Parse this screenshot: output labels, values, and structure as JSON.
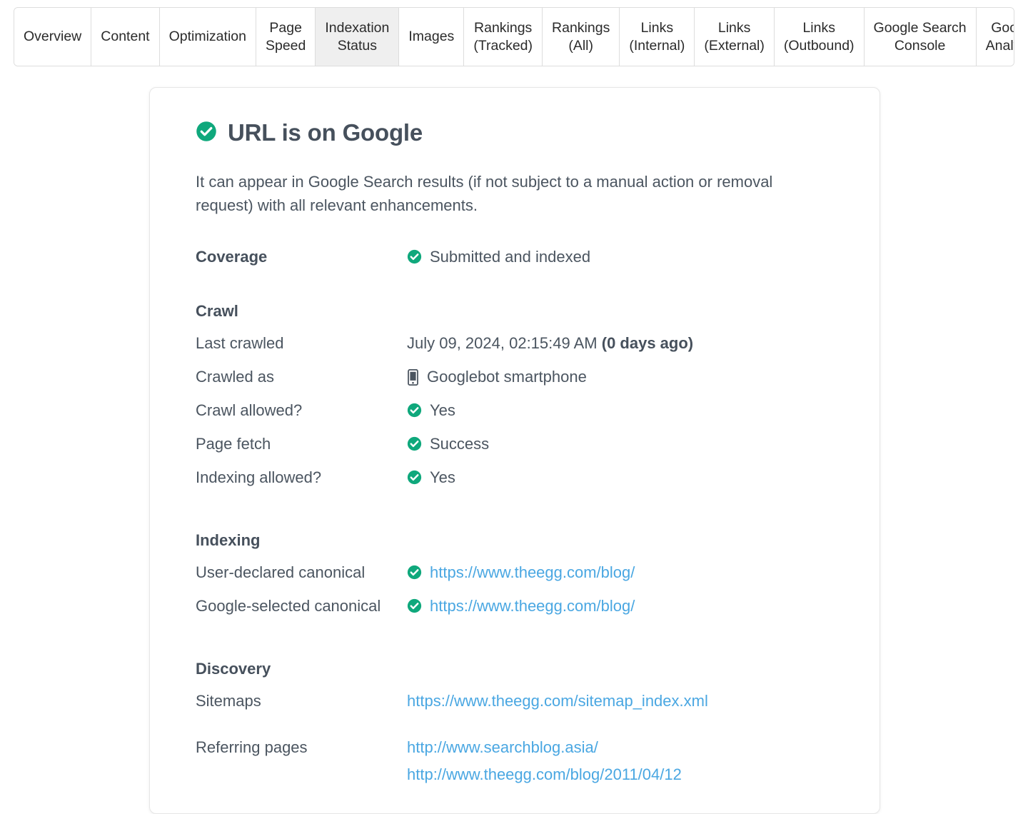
{
  "tabs": [
    {
      "label": "Overview",
      "active": false,
      "name": "tab-overview"
    },
    {
      "label": "Content",
      "active": false,
      "name": "tab-content"
    },
    {
      "label": "Optimization",
      "active": false,
      "name": "tab-optimization"
    },
    {
      "label": "Page\nSpeed",
      "active": false,
      "name": "tab-page-speed"
    },
    {
      "label": "Indexation\nStatus",
      "active": true,
      "name": "tab-indexation-status"
    },
    {
      "label": "Images",
      "active": false,
      "name": "tab-images"
    },
    {
      "label": "Rankings\n(Tracked)",
      "active": false,
      "name": "tab-rankings-tracked"
    },
    {
      "label": "Rankings\n(All)",
      "active": false,
      "name": "tab-rankings-all"
    },
    {
      "label": "Links\n(Internal)",
      "active": false,
      "name": "tab-links-internal"
    },
    {
      "label": "Links\n(External)",
      "active": false,
      "name": "tab-links-external"
    },
    {
      "label": "Links\n(Outbound)",
      "active": false,
      "name": "tab-links-outbound"
    },
    {
      "label": "Google Search\nConsole",
      "active": false,
      "name": "tab-google-search-console"
    },
    {
      "label": "Google\nAnalytics",
      "active": false,
      "name": "tab-google-analytics"
    }
  ],
  "card": {
    "title": "URL is on Google",
    "title_icon": "check-circle-icon",
    "intro": "It can appear in Google Search results (if not subject to a manual action or removal request) with all relevant enhancements.",
    "coverage": {
      "label": "Coverage",
      "icon": "check-circle-icon",
      "value": "Submitted and indexed"
    },
    "crawl": {
      "heading": "Crawl",
      "rows": [
        {
          "label": "Last crawled",
          "value": "July 09, 2024, 02:15:49 AM ",
          "value_bold": "(0 days ago)",
          "icon": null
        },
        {
          "label": "Crawled as",
          "value": "Googlebot smartphone",
          "icon": "smartphone-icon"
        },
        {
          "label": "Crawl allowed?",
          "value": "Yes",
          "icon": "check-circle-icon"
        },
        {
          "label": "Page fetch",
          "value": "Success",
          "icon": "check-circle-icon"
        },
        {
          "label": "Indexing allowed?",
          "value": "Yes",
          "icon": "check-circle-icon"
        }
      ]
    },
    "indexing": {
      "heading": "Indexing",
      "rows": [
        {
          "label": "User-declared canonical",
          "link": "https://www.theegg.com/blog/",
          "icon": "check-circle-icon"
        },
        {
          "label": "Google-selected canonical",
          "link": "https://www.theegg.com/blog/",
          "icon": "check-circle-icon"
        }
      ]
    },
    "discovery": {
      "heading": "Discovery",
      "sitemaps_label": "Sitemaps",
      "sitemaps_link": "https://www.theegg.com/sitemap_index.xml",
      "referring_label": "Referring pages",
      "referring_links": [
        "http://www.searchblog.asia/",
        "http://www.theegg.com/blog/2011/04/12"
      ]
    }
  },
  "colors": {
    "success_green": "#0fa87c",
    "link_blue": "#4aa7e2",
    "heading_gray": "#46505c",
    "body_gray": "#4b5560",
    "tab_active_bg": "#efefef",
    "border_gray": "#dddddd"
  }
}
